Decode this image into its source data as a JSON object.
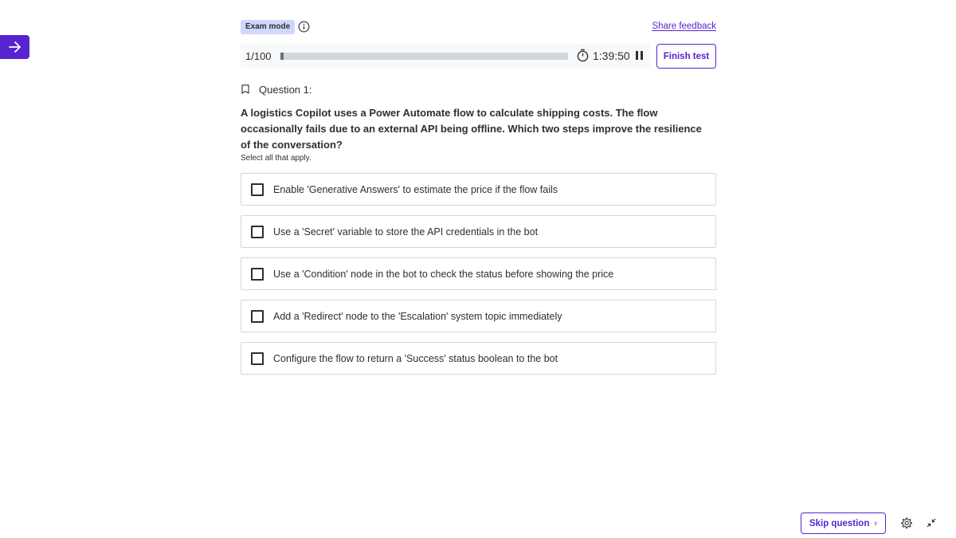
{
  "header": {
    "exam_mode_label": "Exam mode",
    "share_feedback_label": "Share feedback",
    "finish_label": "Finish test"
  },
  "progress": {
    "count_text": "1/100",
    "current": 1,
    "total": 100,
    "fraction": 0.01,
    "timer_text": "1:39:50"
  },
  "question": {
    "label": "Question 1:",
    "text": "A logistics Copilot uses a Power Automate flow to calculate shipping costs. The flow occasionally fails due to an external API being offline. Which two steps improve the resilience of the conversation?",
    "hint": "Select all that apply.",
    "options": [
      {
        "label": "Enable 'Generative Answers' to estimate the price if the flow fails"
      },
      {
        "label": "Use a 'Secret' variable to store the API credentials in the bot"
      },
      {
        "label": "Use a 'Condition' node in the bot to check the status before showing the price"
      },
      {
        "label": "Add a 'Redirect' node to the 'Escalation' system topic immediately"
      },
      {
        "label": "Configure the flow to return a 'Success' status boolean to the bot"
      }
    ]
  },
  "footer": {
    "skip_label": "Skip question",
    "skip_chevron": "›"
  },
  "icons": {
    "side_toggle": "arrow-right-icon",
    "info": "info-icon",
    "timer": "stopwatch-icon",
    "pause": "pause-icon",
    "bookmark": "bookmark-icon",
    "settings": "gear-icon",
    "collapse": "collapse-icon"
  },
  "colors": {
    "accent": "#5624d0",
    "badge_bg": "#d1d7fc",
    "track": "#d1d7dc",
    "strip_bg": "#f7f9fa",
    "text": "#2d2f31"
  }
}
